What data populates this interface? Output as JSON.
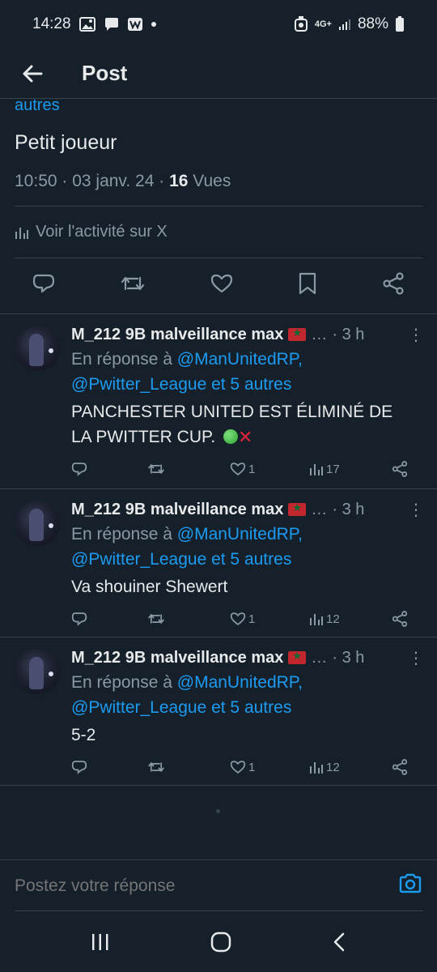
{
  "status_bar": {
    "time": "14:28",
    "network": "4G+",
    "battery": "88%",
    "left_icons": [
      "image-icon",
      "chat-bubble-icon",
      "w-app-icon"
    ],
    "right_icons": [
      "alarm-icon",
      "signal-icon",
      "battery-icon"
    ]
  },
  "header": {
    "title": "Post"
  },
  "main_post": {
    "autres_link": "autres",
    "text": "Petit joueur",
    "timestamp": "10:50 · 03 janv. 24 · ",
    "views_count": "16",
    "views_label": " Vues",
    "activity_label": "Voir l'activité sur X"
  },
  "replies": [
    {
      "name": "M_212 9B malveillance max",
      "ellipsis": "…",
      "time": "· 3 h",
      "reply_prefix": "En réponse à ",
      "mention1": "@ManUnitedRP,",
      "mention2": "@Pwitter_League et 5 autres",
      "text_line1": "PANCHESTER UNITED EST ÉLIMINÉ DE",
      "text_line2": "LA PWITTER CUP.",
      "likes": "1",
      "views": "17"
    },
    {
      "name": "M_212 9B malveillance max",
      "ellipsis": "…",
      "time": "· 3 h",
      "reply_prefix": "En réponse à ",
      "mention1": "@ManUnitedRP,",
      "mention2": "@Pwitter_League et 5 autres",
      "text_line1": "Va shouiner Shewert",
      "likes": "1",
      "views": "12"
    },
    {
      "name": "M_212 9B malveillance max",
      "ellipsis": "…",
      "time": "· 3 h",
      "reply_prefix": "En réponse à ",
      "mention1": "@ManUnitedRP,",
      "mention2": "@Pwitter_League et 5 autres",
      "text_line1": "5-2",
      "likes": "1",
      "views": "12"
    }
  ],
  "compose": {
    "placeholder": "Postez votre réponse"
  },
  "colors": {
    "background": "#15202b",
    "accent": "#1d9bf0",
    "muted": "#8b98a5",
    "text": "#e7e9ea",
    "divider": "#38444d"
  }
}
